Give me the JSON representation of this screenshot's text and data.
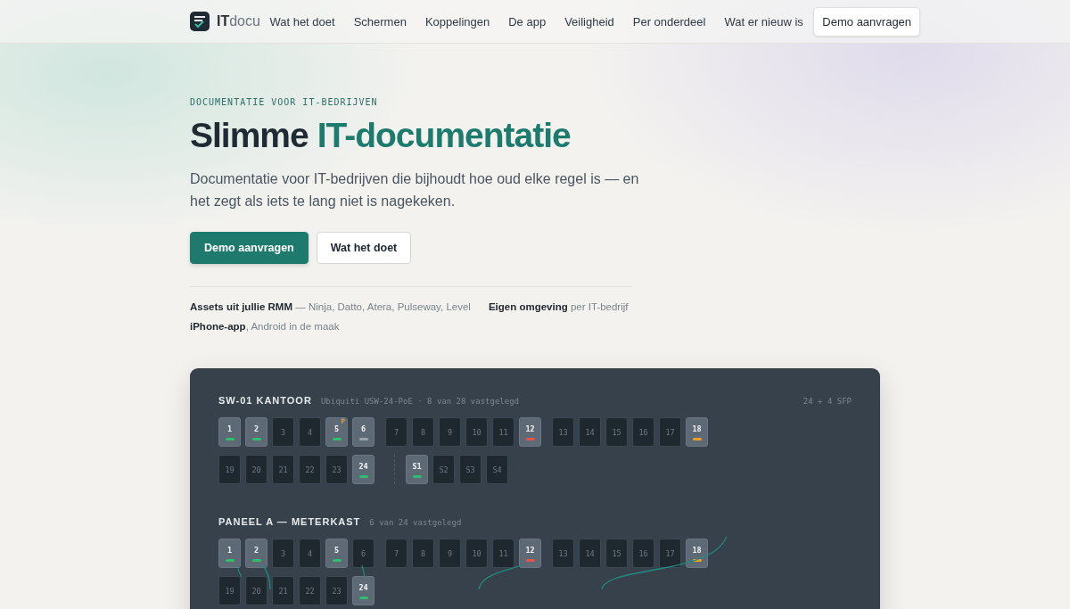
{
  "nav": {
    "brand_bold": "IT",
    "brand_light": "docu",
    "links": [
      "Wat het doet",
      "Schermen",
      "Koppelingen",
      "De app",
      "Veiligheid",
      "Per onderdeel",
      "Wat er nieuw is"
    ],
    "cta": "Demo aanvragen"
  },
  "hero": {
    "eyebrow": "DOCUMENTATIE VOOR IT-BEDRIJVEN",
    "title_lead": "Slimme",
    "title_accent": "IT-documentatie",
    "lead": "Documentatie voor IT-bedrijven die bijhoudt hoe oud elke regel is — en het zegt als iets te lang niet is nagekeken.",
    "buttons": [
      {
        "label": "Demo aanvragen",
        "kind": "primary"
      },
      {
        "label": "Wat het doet",
        "kind": "secondary"
      }
    ],
    "facts": [
      "**Assets uit jullie RMM** — Ninja, Datto, Atera, Pulseway, Level",
      "**Eigen omgeving** per IT-bedrijf",
      "**iPhone-app**, Android in de maak"
    ]
  },
  "devices": [
    {
      "kind": "switch",
      "name": "SW-01 KANTOOR",
      "meta": "Ubiquiti USW-24-PoE · 8 van 28 vastgelegd",
      "summary": "24 + 4 SFP",
      "rows": [
        [
          [
            {
              "label": "1",
              "color": "#2fbf71"
            },
            {
              "label": "2",
              "color": "#2fbf71"
            },
            {
              "label": "3"
            },
            {
              "label": "4"
            },
            {
              "label": "5",
              "color": "#2fbf71",
              "badge": "P"
            },
            {
              "label": "6",
              "color": "#9aa3ab"
            }
          ],
          [
            {
              "label": "7"
            },
            {
              "label": "8"
            },
            {
              "label": "9"
            },
            {
              "label": "10"
            },
            {
              "label": "11"
            },
            {
              "label": "12",
              "color": "#e5534b"
            }
          ],
          [
            {
              "label": "13"
            },
            {
              "label": "14"
            },
            {
              "label": "15"
            },
            {
              "label": "16"
            },
            {
              "label": "17"
            },
            {
              "label": "18",
              "color": "#f0a020"
            }
          ]
        ],
        [
          [
            {
              "label": "19"
            },
            {
              "label": "20"
            },
            {
              "label": "21"
            },
            {
              "label": "22"
            },
            {
              "label": "23"
            },
            {
              "label": "24",
              "color": "#2fbf71"
            }
          ],
          [
            {
              "label": "S1",
              "color": "#2fbf71"
            },
            {
              "label": "S2"
            },
            {
              "label": "S3"
            },
            {
              "label": "S4"
            }
          ]
        ]
      ]
    },
    {
      "kind": "panel",
      "name": "PANEEL A — METERKAST",
      "meta": "6 van 24 vastgelegd",
      "rows": [
        [
          [
            {
              "label": "1",
              "color": "#2fbf71"
            },
            {
              "label": "2",
              "color": "#2fbf71"
            },
            {
              "label": "3"
            },
            {
              "label": "4"
            },
            {
              "label": "5",
              "color": "#2fbf71"
            },
            {
              "label": "6"
            }
          ],
          [
            {
              "label": "7"
            },
            {
              "label": "8"
            },
            {
              "label": "9"
            },
            {
              "label": "10"
            },
            {
              "label": "11"
            },
            {
              "label": "12",
              "color": "#e5534b"
            }
          ],
          [
            {
              "label": "13"
            },
            {
              "label": "14"
            },
            {
              "label": "15"
            },
            {
              "label": "16"
            },
            {
              "label": "17"
            },
            {
              "label": "18",
              "color": "#f0a020"
            }
          ]
        ],
        [
          [
            {
              "label": "19"
            },
            {
              "label": "20"
            },
            {
              "label": "21"
            },
            {
              "label": "22"
            },
            {
              "label": "23"
            },
            {
              "label": "24",
              "color": "#2fbf71"
            }
          ]
        ]
      ]
    }
  ]
}
